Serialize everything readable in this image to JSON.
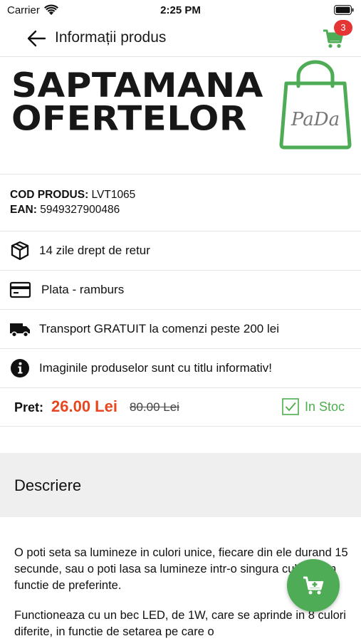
{
  "status_bar": {
    "carrier": "Carrier",
    "time": "2:25 PM"
  },
  "nav": {
    "title": "Informații produs",
    "cart_count": "3"
  },
  "banner": {
    "line1": "SAPTAMANA",
    "line2": "OFERTELOR",
    "logo_text": "PaDa"
  },
  "product": {
    "code_label": "COD PRODUS:",
    "code_value": " LVT1065",
    "ean_label": "EAN:",
    "ean_value": " 5949327900486"
  },
  "info_rows": [
    {
      "icon": "return-box-icon",
      "text": "14 zile drept de retur"
    },
    {
      "icon": "credit-card-icon",
      "text": "Plata - ramburs"
    },
    {
      "icon": "truck-icon",
      "text": "Transport GRATUIT la comenzi peste 200 lei"
    },
    {
      "icon": "info-icon",
      "text": "Imaginile produselor sunt cu titlu informativ!"
    }
  ],
  "price": {
    "label": "Pret:",
    "current": "26.00 Lei",
    "old": "80.00 Lei",
    "stock": "In Stoc"
  },
  "description": {
    "title": "Descriere",
    "paragraphs": [
      "O poti seta sa lumineze in culori unice, fiecare din ele durand 15 secunde, sau o poti lasa sa lumineze intr-o singura culoare, in functie de preferinte.",
      "Functioneaza cu un bec LED, de 1W,  care se aprinde in 8 culori diferite, in functie de setarea pe care o"
    ]
  },
  "colors": {
    "accent_green": "#4fac56",
    "price_red": "#e8461e",
    "badge_red": "#e53434"
  }
}
